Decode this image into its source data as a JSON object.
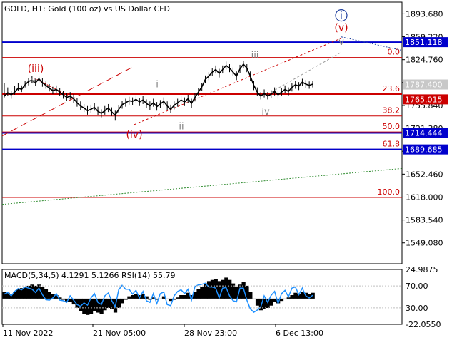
{
  "header": {
    "symbol_text": "GOLD, H1:  Gold (100 oz) vs US Dollar CFD"
  },
  "colors": {
    "background": "#ffffff",
    "candles": "#000000",
    "fib_lines": "#cc0000",
    "blue_levels": "#0000cc",
    "wave_main": "#cc0000",
    "wave_sub": "#808080",
    "wave_top": "#1f3f9f",
    "trend_green": "#2e8b2e",
    "macd_hist": "#000000",
    "rsi_line": "#1e90ff",
    "axis": "#000000",
    "grid": "#c0c0c0"
  },
  "chart_data": [
    {
      "type": "line",
      "title": "GOLD, H1:  Gold (100 oz) vs US Dollar CFD",
      "x": [
        "11 Nov 2022",
        "21 Nov 05:00",
        "28 Nov 23:00",
        "6 Dec 13:00"
      ],
      "y_ticks": [
        1893.68,
        1859.22,
        1824.76,
        1790.3,
        1755.84,
        1721.38,
        1686.92,
        1652.46,
        1618.0,
        1583.54,
        1549.08
      ],
      "y_tick_labels": [
        "1893.680",
        "1859.220",
        "1824.760",
        "1790.300",
        "1755.840",
        "1721.380",
        "1686.920",
        "1652.460",
        "1618.000",
        "1583.540",
        "1549.080"
      ],
      "ylim": [
        1517.7,
        1911.3
      ],
      "price_axis_labels": [
        {
          "value": 1851.118,
          "text": "1851.118",
          "style": "blue"
        },
        {
          "value": 1787.4,
          "text": "1787.400",
          "style": "gray"
        },
        {
          "value": 1765.015,
          "text": "1765.015",
          "style": "red"
        },
        {
          "value": 1714.444,
          "text": "1714.444",
          "style": "blue"
        },
        {
          "value": 1689.685,
          "text": "1689.685",
          "style": "blue"
        }
      ],
      "fib_levels": [
        {
          "label": "0.0",
          "value": 1828.0
        },
        {
          "label": "23.6",
          "value": 1773.0
        },
        {
          "label": "38.2",
          "value": 1740.0
        },
        {
          "label": "50.0",
          "value": 1716.0
        },
        {
          "label": "61.8",
          "value": 1690.0
        },
        {
          "label": "100.0",
          "value": 1617.5
        }
      ],
      "wave_labels": [
        {
          "text": "(iii)",
          "style": "main"
        },
        {
          "text": "v",
          "style": "sub"
        },
        {
          "text": "(iv)",
          "style": "main"
        },
        {
          "text": "i",
          "style": "sub"
        },
        {
          "text": "ii",
          "style": "sub"
        },
        {
          "text": "iii",
          "style": "sub"
        },
        {
          "text": "iv",
          "style": "sub"
        },
        {
          "text": "v",
          "style": "sub"
        },
        {
          "text": "(v)",
          "style": "main"
        },
        {
          "text": "i",
          "style": "top"
        }
      ],
      "price_path": [
        [
          1770,
          1790,
          1768
        ],
        [
          1775,
          1783,
          1770
        ],
        [
          1772,
          1778,
          1766
        ],
        [
          1776,
          1785,
          1772
        ],
        [
          1782,
          1790,
          1778
        ],
        [
          1780,
          1786,
          1776
        ],
        [
          1787,
          1793,
          1783
        ],
        [
          1792,
          1797,
          1786
        ],
        [
          1794,
          1800,
          1789
        ],
        [
          1790,
          1796,
          1785
        ],
        [
          1796,
          1801,
          1790
        ],
        [
          1790,
          1797,
          1784
        ],
        [
          1786,
          1792,
          1781
        ],
        [
          1782,
          1788,
          1777
        ],
        [
          1778,
          1784,
          1773
        ],
        [
          1780,
          1786,
          1775
        ],
        [
          1776,
          1782,
          1770
        ],
        [
          1772,
          1778,
          1766
        ],
        [
          1768,
          1775,
          1763
        ],
        [
          1770,
          1776,
          1765
        ],
        [
          1766,
          1773,
          1760
        ],
        [
          1760,
          1767,
          1754
        ],
        [
          1755,
          1762,
          1749
        ],
        [
          1752,
          1758,
          1746
        ],
        [
          1748,
          1755,
          1742
        ],
        [
          1750,
          1757,
          1744
        ],
        [
          1753,
          1760,
          1748
        ],
        [
          1747,
          1754,
          1741
        ],
        [
          1744,
          1750,
          1738
        ],
        [
          1748,
          1755,
          1742
        ],
        [
          1752,
          1758,
          1746
        ],
        [
          1746,
          1753,
          1740
        ],
        [
          1741,
          1748,
          1733
        ],
        [
          1750,
          1756,
          1744
        ],
        [
          1757,
          1763,
          1751
        ],
        [
          1760,
          1766,
          1754
        ],
        [
          1763,
          1769,
          1757
        ],
        [
          1762,
          1768,
          1756
        ],
        [
          1765,
          1771,
          1759
        ],
        [
          1761,
          1767,
          1755
        ],
        [
          1764,
          1770,
          1758
        ],
        [
          1759,
          1765,
          1752
        ],
        [
          1755,
          1762,
          1749
        ],
        [
          1760,
          1766,
          1754
        ],
        [
          1754,
          1761,
          1748
        ],
        [
          1758,
          1764,
          1752
        ],
        [
          1762,
          1768,
          1756
        ],
        [
          1755,
          1762,
          1749
        ],
        [
          1750,
          1757,
          1744
        ],
        [
          1756,
          1762,
          1750
        ],
        [
          1760,
          1766,
          1754
        ],
        [
          1764,
          1770,
          1758
        ],
        [
          1761,
          1768,
          1755
        ],
        [
          1766,
          1772,
          1760
        ],
        [
          1759,
          1766,
          1752
        ],
        [
          1768,
          1774,
          1762
        ],
        [
          1776,
          1782,
          1770
        ],
        [
          1784,
          1790,
          1778
        ],
        [
          1795,
          1801,
          1789
        ],
        [
          1800,
          1806,
          1794
        ],
        [
          1806,
          1812,
          1800
        ],
        [
          1810,
          1816,
          1804
        ],
        [
          1804,
          1811,
          1798
        ],
        [
          1810,
          1816,
          1804
        ],
        [
          1816,
          1822,
          1810
        ],
        [
          1812,
          1818,
          1806
        ],
        [
          1806,
          1813,
          1800
        ],
        [
          1800,
          1807,
          1794
        ],
        [
          1811,
          1817,
          1805
        ],
        [
          1818,
          1823,
          1812
        ],
        [
          1812,
          1818,
          1806
        ],
        [
          1800,
          1807,
          1793
        ],
        [
          1786,
          1793,
          1779
        ],
        [
          1776,
          1783,
          1770
        ],
        [
          1770,
          1776,
          1765
        ],
        [
          1774,
          1780,
          1768
        ],
        [
          1770,
          1776,
          1765
        ],
        [
          1773,
          1779,
          1767
        ],
        [
          1777,
          1783,
          1771
        ],
        [
          1772,
          1778,
          1766
        ],
        [
          1776,
          1782,
          1770
        ],
        [
          1780,
          1786,
          1774
        ],
        [
          1777,
          1783,
          1771
        ],
        [
          1783,
          1789,
          1777
        ],
        [
          1787,
          1793,
          1781
        ],
        [
          1785,
          1791,
          1779
        ],
        [
          1791,
          1796,
          1785
        ],
        [
          1788,
          1794,
          1782
        ],
        [
          1786,
          1792,
          1781
        ],
        [
          1788,
          1793,
          1783
        ]
      ]
    },
    {
      "type": "bar",
      "title": "MACD(5,34,5) 4.1291 5.1266 RSI(14) 55.79",
      "y_tick_labels": [
        "24.9875",
        "70.00",
        "30.00",
        "-22.0550"
      ],
      "macd_hist": [
        6,
        5,
        4,
        6,
        8,
        9,
        10,
        11,
        12,
        11,
        12,
        10,
        8,
        6,
        4,
        3,
        1,
        -1,
        -3,
        -3,
        -5,
        -8,
        -11,
        -13,
        -14,
        -13,
        -11,
        -12,
        -13,
        -10,
        -8,
        -9,
        -12,
        -8,
        -4,
        -1,
        2,
        3,
        4,
        3,
        4,
        2,
        -1,
        1,
        -1,
        0,
        2,
        0,
        -2,
        -1,
        1,
        3,
        3,
        5,
        3,
        6,
        8,
        10,
        13,
        15,
        16,
        17,
        15,
        16,
        18,
        16,
        13,
        10,
        12,
        14,
        11,
        6,
        0,
        -6,
        -10,
        -9,
        -8,
        -6,
        -3,
        -4,
        -2,
        0,
        1,
        3,
        5,
        4,
        6,
        5,
        4,
        5
      ],
      "rsi": [
        55,
        58,
        52,
        60,
        65,
        63,
        68,
        66,
        64,
        58,
        66,
        54,
        45,
        44,
        48,
        56,
        44,
        43,
        40,
        52,
        44,
        36,
        33,
        39,
        35,
        48,
        56,
        40,
        36,
        52,
        57,
        43,
        32,
        63,
        71,
        64,
        64,
        55,
        62,
        48,
        60,
        43,
        40,
        56,
        38,
        56,
        59,
        36,
        34,
        52,
        60,
        63,
        56,
        64,
        44,
        69,
        72,
        73,
        75,
        68,
        68,
        66,
        48,
        66,
        67,
        52,
        43,
        41,
        66,
        66,
        44,
        28,
        22,
        26,
        32,
        52,
        40,
        53,
        60,
        38,
        56,
        62,
        50,
        66,
        68,
        54,
        66,
        52,
        48,
        53
      ]
    }
  ],
  "time_labels": [
    "11 Nov 2022",
    "21 Nov 05:00",
    "28 Nov 23:00",
    "6 Dec 13:00"
  ]
}
